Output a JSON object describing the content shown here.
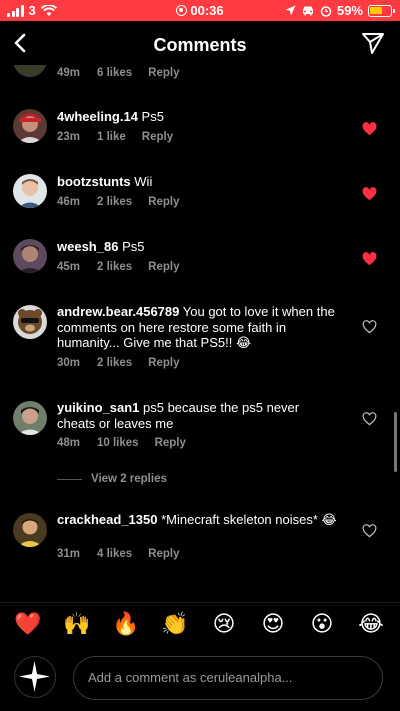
{
  "status_bar": {
    "carrier": "3",
    "time": "00:36",
    "battery": "59%"
  },
  "header": {
    "title": "Comments"
  },
  "partial_comment": {
    "time": "49m",
    "likes": "6 likes",
    "reply": "Reply"
  },
  "comments": [
    {
      "username": "4wheeling.14",
      "text": "Ps5",
      "time": "23m",
      "likes": "1 like",
      "reply": "Reply",
      "liked": true
    },
    {
      "username": "bootzstunts",
      "text": "Wii",
      "time": "46m",
      "likes": "2 likes",
      "reply": "Reply",
      "liked": true
    },
    {
      "username": "weesh_86",
      "text": "Ps5",
      "time": "45m",
      "likes": "2 likes",
      "reply": "Reply",
      "liked": true
    },
    {
      "username": "andrew.bear.456789",
      "text": "You got to love it when the comments on here restore some faith in humanity... Give me that PS5!! 😂",
      "time": "30m",
      "likes": "2 likes",
      "reply": "Reply",
      "liked": false
    },
    {
      "username": "yuikino_san1",
      "text": "ps5 because the ps5 never cheats or leaves me",
      "time": "48m",
      "likes": "10 likes",
      "reply": "Reply",
      "liked": false,
      "view_replies": "View 2 replies"
    },
    {
      "username": "crackhead_1350",
      "text": "*Minecraft skeleton noises* 😂",
      "time": "31m",
      "likes": "4 likes",
      "reply": "Reply",
      "liked": false
    }
  ],
  "emoji_bar": [
    "❤️",
    "🙌",
    "🔥",
    "👏",
    "😢",
    "😍",
    "😮",
    "😂"
  ],
  "composer": {
    "placeholder": "Add a comment as ceruleanalpha..."
  },
  "colors": {
    "status_bar": "#ff3b41",
    "like_red": "#ff3040",
    "muted_text": "#8e8e8e"
  }
}
